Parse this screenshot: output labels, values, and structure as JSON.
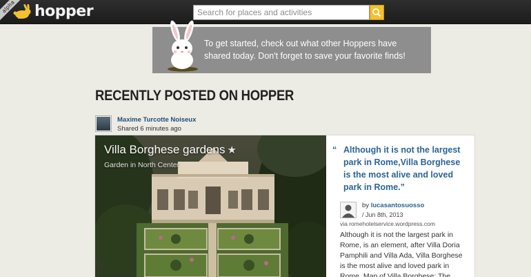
{
  "topbar": {
    "alpha_label": "alpha",
    "logo_text": "hopper",
    "search_placeholder": "Search for places and activities"
  },
  "banner": {
    "text": "To get started, check out what other Hoppers have shared today. Don't forget to save your favorite finds!"
  },
  "section_title": "RECENTLY POSTED ON HOPPER",
  "post": {
    "author": "Maxime Turcotte Noiseux",
    "shared_time": "Shared 6 minutes ago",
    "photo_title": "Villa Borghese gardens",
    "photo_subtitle": "Garden in North Center",
    "quote_open": "“",
    "quote": "Although it is not the largest park in Rome,Villa Borghese is the most alive and loved park in Rome.”",
    "by_prefix": "by",
    "by_user": "lucasantosuosso",
    "date": "/ Jun 8th, 2013",
    "via": "via romehotelservice.wordpress.com",
    "excerpt": "Although it is not the largest park in Rome, is an element, after Villa Doria Pamphili and Villa Ada, Villa Borghese is the most alive and loved park in Rome. Map of Villa Borghese: The"
  },
  "colors": {
    "topbar": "#222222",
    "accent_search_button": "#f2c12e",
    "banner": "#8e8e8e",
    "link_blue": "#2a6496",
    "page_background": "#ecebe4"
  }
}
